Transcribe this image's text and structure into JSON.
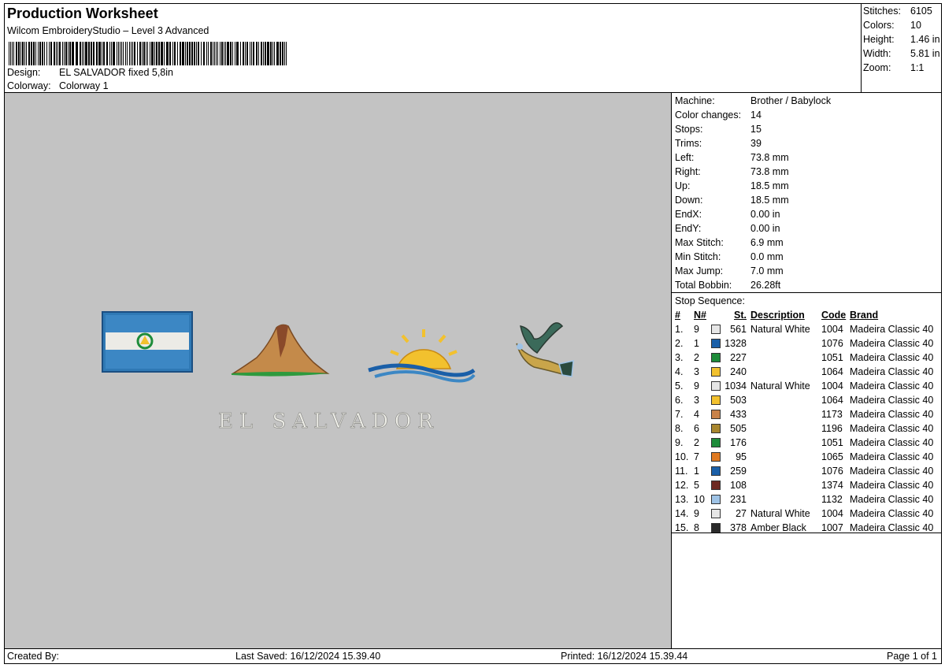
{
  "header": {
    "title": "Production Worksheet",
    "subtitle": "Wilcom EmbroideryStudio – Level 3 Advanced",
    "design_label": "Design:",
    "design_value": "EL SALVADOR fixed 5,8in",
    "colorway_label": "Colorway:",
    "colorway_value": "Colorway 1"
  },
  "summary": [
    {
      "label": "Stitches:",
      "value": "6105"
    },
    {
      "label": "Colors:",
      "value": "10"
    },
    {
      "label": "Height:",
      "value": "1.46 in"
    },
    {
      "label": "Width:",
      "value": "5.81 in"
    },
    {
      "label": "Zoom:",
      "value": "1:1"
    }
  ],
  "details": [
    {
      "label": "Machine:",
      "value": "Brother / Babylock"
    },
    {
      "label": "Color changes:",
      "value": "14"
    },
    {
      "label": "Stops:",
      "value": "15"
    },
    {
      "label": "Trims:",
      "value": "39"
    },
    {
      "label": "Left:",
      "value": "73.8 mm"
    },
    {
      "label": "Right:",
      "value": "73.8 mm"
    },
    {
      "label": "Up:",
      "value": "18.5 mm"
    },
    {
      "label": "Down:",
      "value": "18.5 mm"
    },
    {
      "label": "EndX:",
      "value": "0.00 in"
    },
    {
      "label": "EndY:",
      "value": "0.00 in"
    },
    {
      "label": "Max Stitch:",
      "value": "6.9 mm"
    },
    {
      "label": "Min Stitch:",
      "value": "0.0 mm"
    },
    {
      "label": "Max Jump:",
      "value": "7.0 mm"
    },
    {
      "label": "Total Bobbin:",
      "value": "26.28ft"
    }
  ],
  "stop_sequence": {
    "title": "Stop Sequence:",
    "headers": {
      "num": "#",
      "n": "N#",
      "st": "St.",
      "desc": "Description",
      "code": "Code",
      "brand": "Brand"
    },
    "rows": [
      {
        "num": "1.",
        "n": "9",
        "color": "#e6e6e6",
        "st": "561",
        "desc": "Natural White",
        "code": "1004",
        "brand": "Madeira Classic 40"
      },
      {
        "num": "2.",
        "n": "1",
        "color": "#1a5fa8",
        "st": "1328",
        "desc": "",
        "code": "1076",
        "brand": "Madeira Classic 40"
      },
      {
        "num": "3.",
        "n": "2",
        "color": "#1e8c3a",
        "st": "227",
        "desc": "",
        "code": "1051",
        "brand": "Madeira Classic 40"
      },
      {
        "num": "4.",
        "n": "3",
        "color": "#f2c12e",
        "st": "240",
        "desc": "",
        "code": "1064",
        "brand": "Madeira Classic 40"
      },
      {
        "num": "5.",
        "n": "9",
        "color": "#e6e6e6",
        "st": "1034",
        "desc": "Natural White",
        "code": "1004",
        "brand": "Madeira Classic 40"
      },
      {
        "num": "6.",
        "n": "3",
        "color": "#f2c12e",
        "st": "503",
        "desc": "",
        "code": "1064",
        "brand": "Madeira Classic 40"
      },
      {
        "num": "7.",
        "n": "4",
        "color": "#c8824a",
        "st": "433",
        "desc": "",
        "code": "1173",
        "brand": "Madeira Classic 40"
      },
      {
        "num": "8.",
        "n": "6",
        "color": "#a8862e",
        "st": "505",
        "desc": "",
        "code": "1196",
        "brand": "Madeira Classic 40"
      },
      {
        "num": "9.",
        "n": "2",
        "color": "#1e8c3a",
        "st": "176",
        "desc": "",
        "code": "1051",
        "brand": "Madeira Classic 40"
      },
      {
        "num": "10.",
        "n": "7",
        "color": "#e07a22",
        "st": "95",
        "desc": "",
        "code": "1065",
        "brand": "Madeira Classic 40"
      },
      {
        "num": "11.",
        "n": "1",
        "color": "#1a5fa8",
        "st": "259",
        "desc": "",
        "code": "1076",
        "brand": "Madeira Classic 40"
      },
      {
        "num": "12.",
        "n": "5",
        "color": "#6e2a22",
        "st": "108",
        "desc": "",
        "code": "1374",
        "brand": "Madeira Classic 40"
      },
      {
        "num": "13.",
        "n": "10",
        "color": "#9ec3e6",
        "st": "231",
        "desc": "",
        "code": "1132",
        "brand": "Madeira Classic 40"
      },
      {
        "num": "14.",
        "n": "9",
        "color": "#e6e6e6",
        "st": "27",
        "desc": "Natural White",
        "code": "1004",
        "brand": "Madeira Classic 40"
      },
      {
        "num": "15.",
        "n": "8",
        "color": "#2a2a2a",
        "st": "378",
        "desc": "Amber Black",
        "code": "1007",
        "brand": "Madeira Classic 40"
      }
    ]
  },
  "design": {
    "text": "EL SALVADOR"
  },
  "footer": {
    "created_by": "Created By:",
    "last_saved": "Last Saved: 16/12/2024 15.39.40",
    "printed": "Printed: 16/12/2024 15.39.44",
    "page": "Page 1 of 1"
  }
}
